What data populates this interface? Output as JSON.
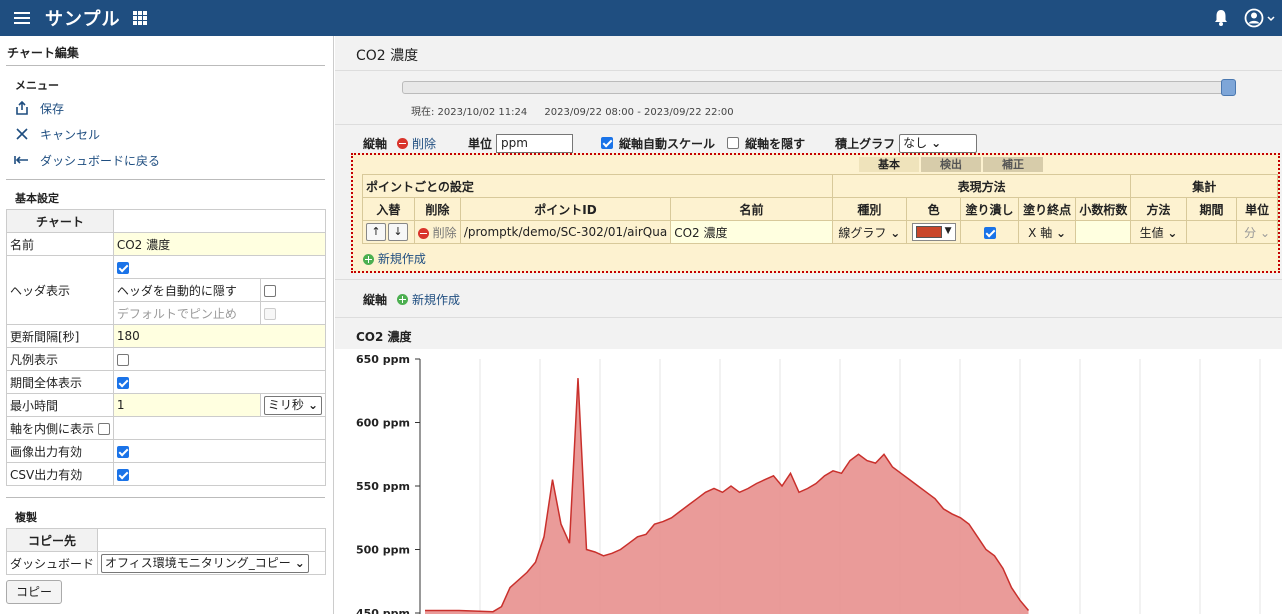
{
  "app": {
    "title": "サンプル",
    "menu_icon": "hamburger-icon",
    "apps_icon": "grid-icon",
    "bell_icon": "bell-icon",
    "user_icon": "account-circle-icon"
  },
  "left": {
    "title": "チャート編集",
    "menu_section": "メニュー",
    "menu_items": [
      {
        "label": "保存",
        "icon": "share-icon"
      },
      {
        "label": "キャンセル",
        "icon": "close-icon"
      },
      {
        "label": "ダッシュボードに戻る",
        "icon": "back-arrow-icon"
      }
    ],
    "basic_section": "基本設定",
    "basic_header": "チャート",
    "name_label": "名前",
    "name_value": "CO2 濃度",
    "header_label": "ヘッダ表示",
    "auto_hide_label": "ヘッダを自動的に隠す",
    "pin_label": "デフォルトでピン止め",
    "interval_label": "更新間隔[秒]",
    "interval_value": "180",
    "legend_label": "凡例表示",
    "period_label": "期間全体表示",
    "mintime_label": "最小時間",
    "mintime_value": "1",
    "mintime_unit": "ミリ秒",
    "inner_axis_label": "軸を内側に表示",
    "image_out_label": "画像出力有効",
    "csv_out_label": "CSV出力有効",
    "copy_section": "複製",
    "copy_header": "コピー先",
    "dashboard_label": "ダッシュボード",
    "dashboard_value": "オフィス環境モニタリング_コピー",
    "copy_button": "コピー"
  },
  "main": {
    "page_title": "CO2 濃度",
    "current": "現在: 2023/10/02 11:24",
    "range": "2023/09/22 08:00 - 2023/09/22 22:00",
    "axis_label": "縦軸",
    "delete_label": "削除",
    "unit_label": "単位",
    "unit_value": "ppm",
    "autoscale_label": "縦軸自動スケール",
    "hide_axis_label": "縦軸を隠す",
    "stack_label": "積上グラフ",
    "stack_value": "なし",
    "tabs": [
      "基本",
      "検出",
      "補正"
    ],
    "point_settings": "ポイントごとの設定",
    "display_method": "表現方法",
    "aggregate": "集計",
    "cols": {
      "swap": "入替",
      "delete": "削除",
      "point_id": "ポイントID",
      "name": "名前",
      "kind": "種別",
      "color": "色",
      "fill": "塗り潰し",
      "fill_end": "塗り終点",
      "decimals": "小数桁数",
      "method": "方法",
      "period": "期間",
      "unit": "単位"
    },
    "row": {
      "up": "↑",
      "down": "↓",
      "delete": "削除",
      "point_id": "/promptk/demo/SC-302/01/airQua",
      "name": "CO2 濃度",
      "kind": "線グラフ",
      "fill_end": "X 軸",
      "method": "生値",
      "unit": "分"
    },
    "new_point": "新規作成",
    "axis2_label": "縦軸",
    "new_axis": "新規作成",
    "chart_title": "CO2 濃度",
    "colors": {
      "accent": "#1f4e80",
      "series": "#d9534f",
      "series_fill": "#e8908e"
    }
  },
  "chart_data": {
    "type": "area",
    "title": "CO2 濃度",
    "ylabel": "",
    "y_ticks": [
      "650 ppm",
      "600 ppm",
      "550 ppm",
      "500 ppm",
      "450 ppm"
    ],
    "ylim": [
      440,
      650
    ],
    "x": [
      0,
      4,
      8,
      9,
      10,
      12,
      13,
      14,
      15,
      16,
      17,
      18,
      19,
      20,
      21,
      22,
      23,
      24,
      25,
      26,
      27,
      28,
      29,
      30,
      31,
      32,
      33,
      34,
      35,
      36,
      37,
      38,
      39,
      40,
      41,
      42,
      43,
      44,
      45,
      46,
      47,
      48,
      49,
      50,
      51,
      52,
      53,
      54,
      55,
      56,
      57,
      58,
      59,
      60,
      61,
      62,
      63,
      64,
      65,
      66,
      67,
      68,
      69,
      70,
      71
    ],
    "values": [
      452,
      452,
      451,
      455,
      470,
      482,
      490,
      510,
      555,
      520,
      505,
      635,
      500,
      498,
      495,
      497,
      500,
      505,
      510,
      512,
      520,
      522,
      525,
      530,
      535,
      540,
      545,
      548,
      545,
      550,
      545,
      548,
      552,
      555,
      558,
      550,
      560,
      545,
      548,
      552,
      558,
      562,
      560,
      570,
      575,
      570,
      568,
      575,
      565,
      560,
      555,
      550,
      545,
      540,
      532,
      528,
      525,
      520,
      510,
      500,
      495,
      485,
      470,
      460,
      452
    ]
  }
}
